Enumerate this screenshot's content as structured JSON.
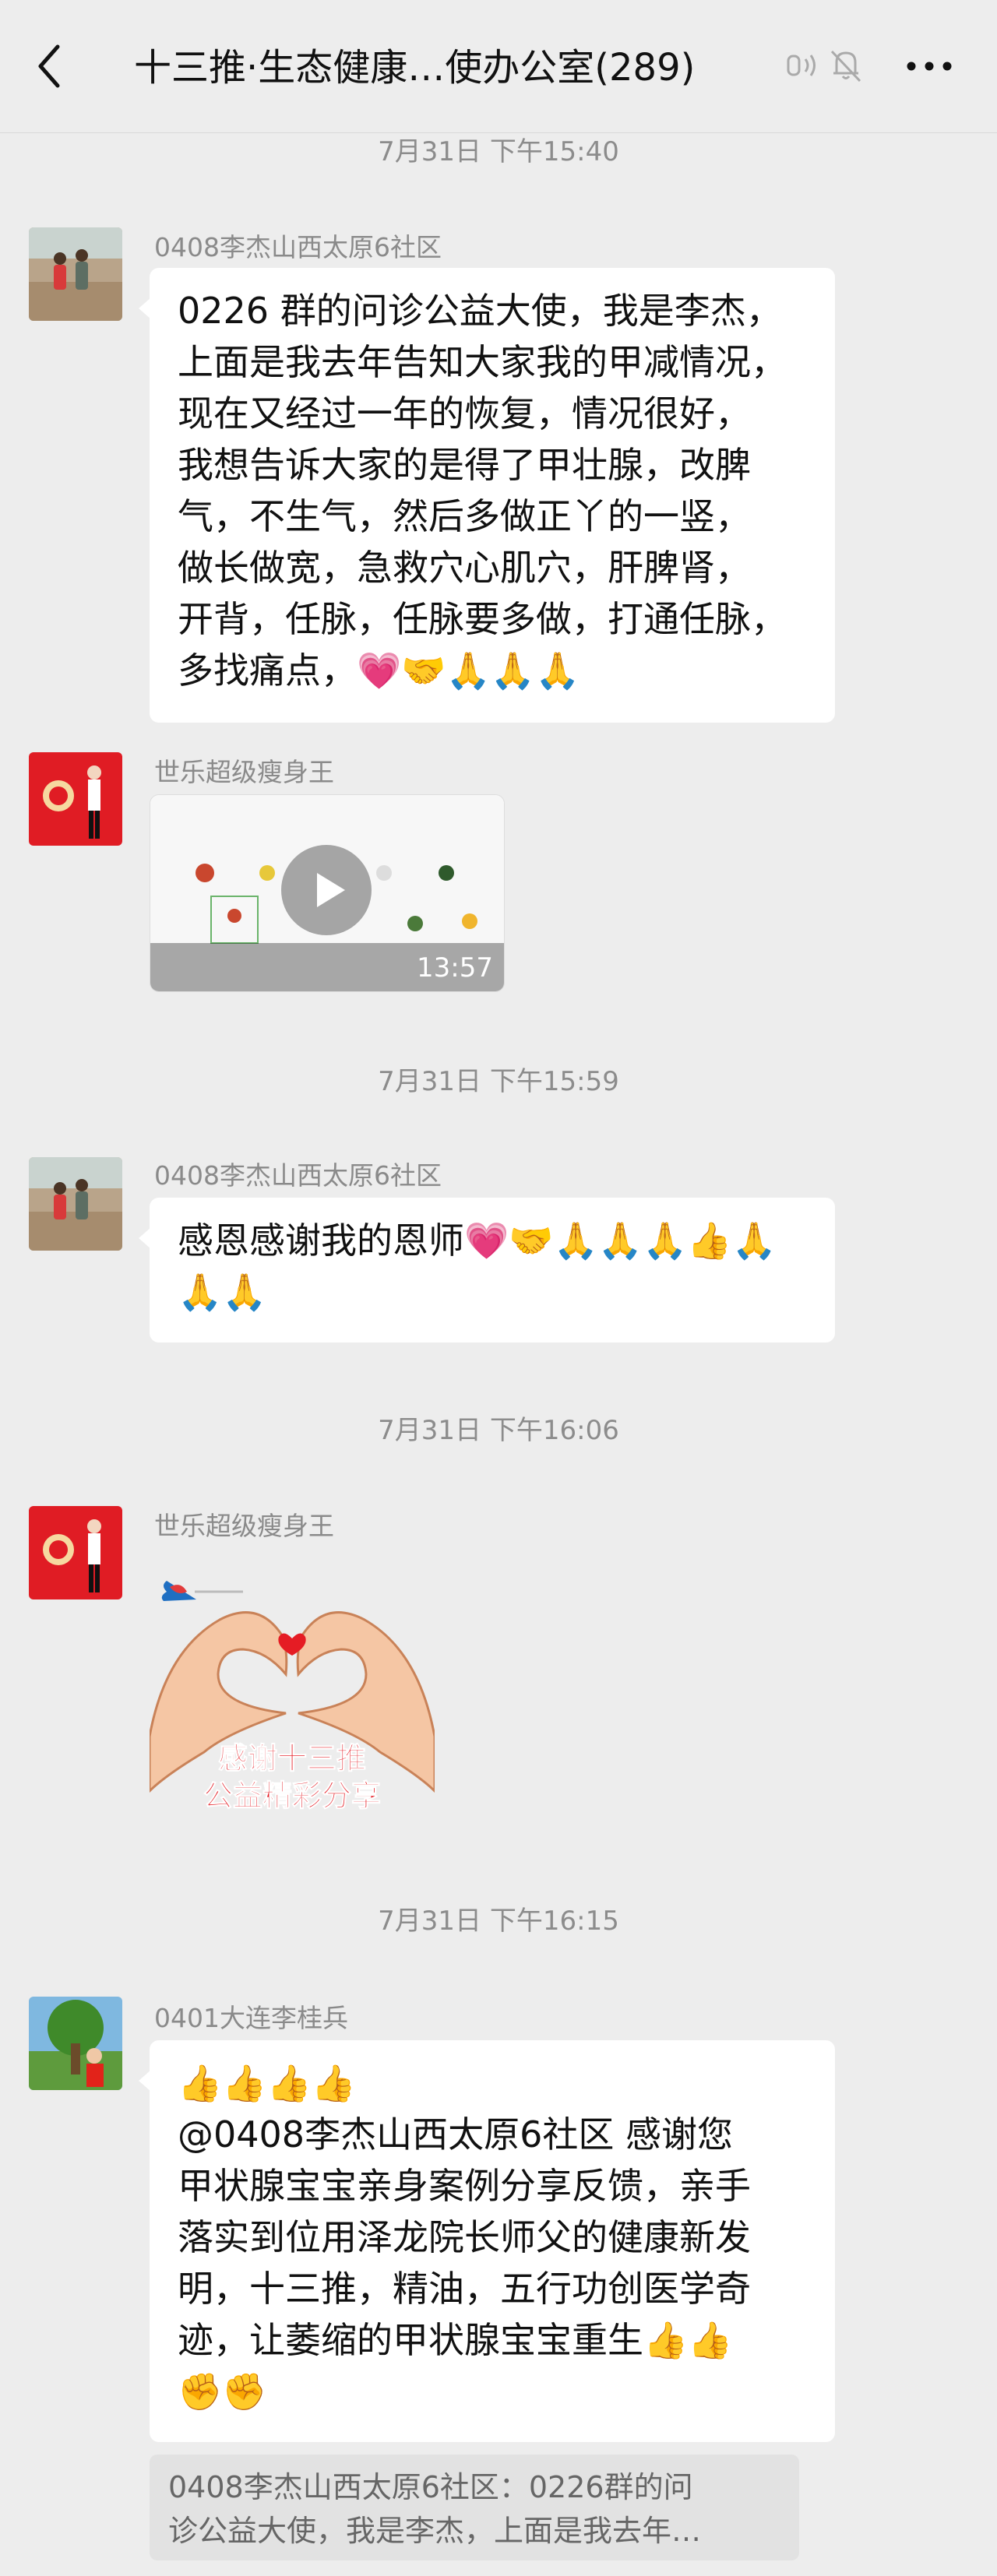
{
  "header": {
    "title": "十三推·生态健康…使办公室(289)",
    "back_icon": "chevron-left-icon",
    "voice_icon": "earpiece-icon",
    "mute_icon": "bell-off-icon",
    "more_icon": "more-horizontal-icon"
  },
  "colors": {
    "background": "#ededed",
    "bubble": "#ffffff",
    "timestamp": "#8c8c8c",
    "sender": "#8a8a8a",
    "quote_bg": "#e2e2e2"
  },
  "timestamps": [
    "7月31日 下午15:40",
    "7月31日 下午15:59",
    "7月31日 下午16:06",
    "7月31日 下午16:15"
  ],
  "messages": [
    {
      "sender": "0408李杰山西太原6社区",
      "lines": [
        "0226 群的问诊公益大使，我是李杰，",
        "上面是我去年告知大家我的甲减情况，",
        "现在又经过一年的恢复，情况很好，",
        "我想告诉大家的是得了甲壮腺，改脾",
        "气，不生气，然后多做正丫的一竖，",
        "做长做宽，急救穴心肌穴，肝脾肾，",
        "开背，任脉，任脉要多做，打通任脉，",
        "多找痛点，💗🤝🙏🙏🙏"
      ]
    },
    {
      "sender": "世乐超级瘦身王",
      "video_duration": "13:57",
      "play_icon": "play-icon"
    },
    {
      "sender": "0408李杰山西太原6社区",
      "lines": [
        "感恩感谢我的恩师💗🤝🙏🙏🙏👍🙏",
        "🙏🙏"
      ]
    },
    {
      "sender": "世乐超级瘦身王",
      "sticker_lines": [
        "感谢十三推",
        "公益精彩分享"
      ]
    },
    {
      "sender": "0401大连李桂兵",
      "lines": [
        "👍👍👍👍",
        "@0408李杰山西太原6社区  感谢您",
        "甲状腺宝宝亲身案例分享反馈，亲手",
        "落实到位用泽龙院长师父的健康新发",
        "明，十三推，精油，五行功创医学奇",
        "迹，让萎缩的甲状腺宝宝重生👍👍",
        "✊✊"
      ],
      "quote_lines": [
        "0408李杰山西太原6社区：0226群的问",
        "诊公益大使，我是李杰，上面是我去年…"
      ]
    }
  ]
}
